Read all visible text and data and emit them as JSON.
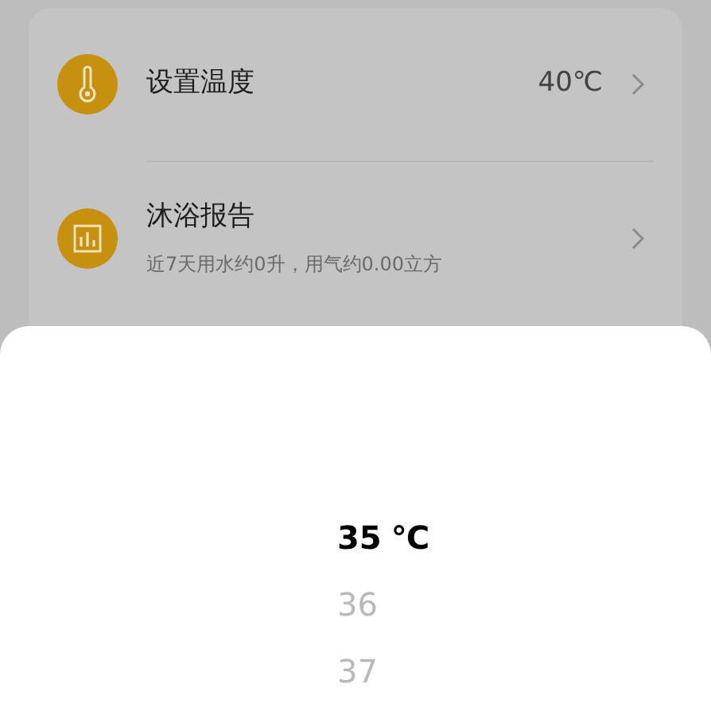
{
  "settings": [
    {
      "kind": "thermometer",
      "title": "设置温度",
      "value": "40℃"
    },
    {
      "kind": "report",
      "title": "沐浴报告",
      "subtitle": "近7天用水约0升，用气约0.00立方"
    }
  ],
  "picker": {
    "unit": "℃",
    "items": [
      {
        "value": "35",
        "selected": true
      },
      {
        "value": "36",
        "selected": false
      },
      {
        "value": "37",
        "selected": false
      }
    ]
  }
}
